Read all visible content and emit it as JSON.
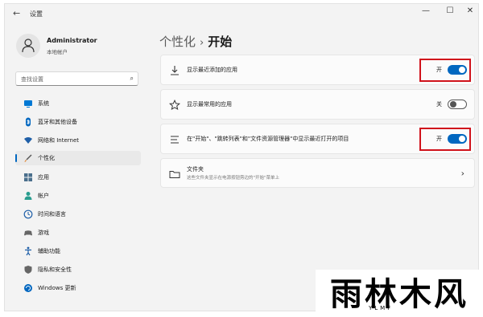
{
  "titlebar": {
    "back": "←",
    "title": "设置",
    "min": "—",
    "max": "☐",
    "close": "✕"
  },
  "profile": {
    "name": "Administrator",
    "account_type": "本地帐户"
  },
  "search": {
    "placeholder": "查找设置",
    "icon": "search-icon"
  },
  "sidebar": {
    "items": [
      {
        "label": "系统",
        "icon": "monitor-icon",
        "selected": false
      },
      {
        "label": "蓝牙和其他设备",
        "icon": "bluetooth-icon",
        "selected": false
      },
      {
        "label": "网络和 Internet",
        "icon": "wifi-icon",
        "selected": false
      },
      {
        "label": "个性化",
        "icon": "brush-icon",
        "selected": true
      },
      {
        "label": "应用",
        "icon": "apps-icon",
        "selected": false
      },
      {
        "label": "帐户",
        "icon": "person-icon",
        "selected": false
      },
      {
        "label": "时间和语言",
        "icon": "globe-clock-icon",
        "selected": false
      },
      {
        "label": "游戏",
        "icon": "gamepad-icon",
        "selected": false
      },
      {
        "label": "辅助功能",
        "icon": "accessibility-icon",
        "selected": false
      },
      {
        "label": "隐私和安全性",
        "icon": "shield-icon",
        "selected": false
      },
      {
        "label": "Windows 更新",
        "icon": "update-icon",
        "selected": false
      }
    ]
  },
  "breadcrumb": {
    "parent": "个性化",
    "separator": "›",
    "current": "开始"
  },
  "settings": [
    {
      "label": "显示最近添加的应用",
      "icon": "download-icon",
      "state_label": "开",
      "on": true,
      "highlighted": true
    },
    {
      "label": "显示最常用的应用",
      "icon": "star-icon",
      "state_label": "关",
      "on": false,
      "highlighted": false
    },
    {
      "label": "在\"开始\"、\"跳转列表\"和\"文件资源管理器\"中显示最近打开的项目",
      "icon": "list-icon",
      "state_label": "开",
      "on": true,
      "highlighted": true
    }
  ],
  "folders": {
    "title": "文件夹",
    "description": "这些文件夹显示在电源按钮旁边的\"开始\"菜单上",
    "icon": "folder-icon"
  },
  "watermark": {
    "main": "雨林木风",
    "sub": "YLMF"
  },
  "colors": {
    "accent": "#0067c0",
    "highlight_box": "#d0121b",
    "background": "#f3f3f3"
  }
}
